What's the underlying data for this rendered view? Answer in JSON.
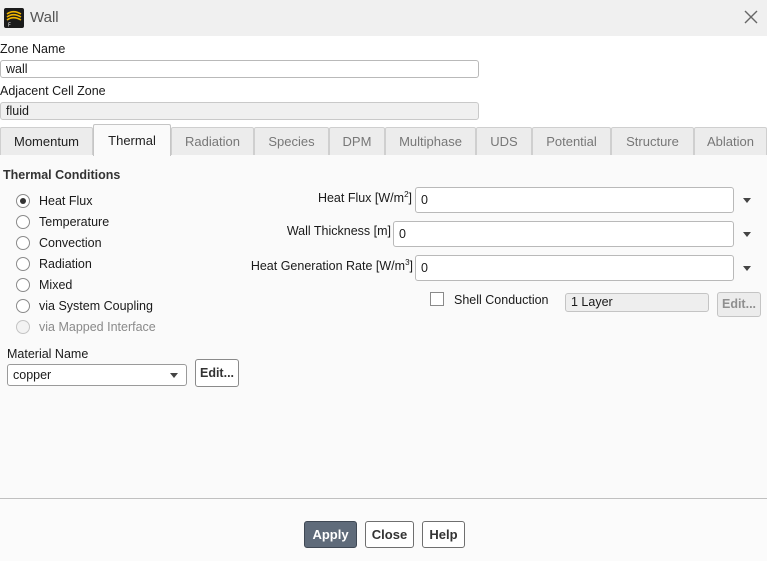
{
  "window": {
    "title": "Wall"
  },
  "upper": {
    "zone_name_label": "Zone Name",
    "zone_name_value": "wall",
    "adjacent_label": "Adjacent Cell Zone",
    "adjacent_value": "fluid"
  },
  "tabs": [
    {
      "label": "Momentum"
    },
    {
      "label": "Thermal"
    },
    {
      "label": "Radiation"
    },
    {
      "label": "Species"
    },
    {
      "label": "DPM"
    },
    {
      "label": "Multiphase"
    },
    {
      "label": "UDS"
    },
    {
      "label": "Potential"
    },
    {
      "label": "Structure"
    },
    {
      "label": "Ablation"
    }
  ],
  "active_tab": "Thermal",
  "thermal": {
    "section_title": "Thermal Conditions",
    "conditions": [
      {
        "label": "Heat Flux",
        "checked": true,
        "disabled": false
      },
      {
        "label": "Temperature",
        "checked": false,
        "disabled": false
      },
      {
        "label": "Convection",
        "checked": false,
        "disabled": false
      },
      {
        "label": "Radiation",
        "checked": false,
        "disabled": false
      },
      {
        "label": "Mixed",
        "checked": false,
        "disabled": false
      },
      {
        "label": "via System Coupling",
        "checked": false,
        "disabled": false
      },
      {
        "label": "via Mapped Interface",
        "checked": false,
        "disabled": true
      }
    ],
    "heat_flux": {
      "label": "Heat Flux [W/m",
      "sup": "2",
      "close": "]",
      "value": "0"
    },
    "wall_thickness": {
      "label": "Wall Thickness [m]",
      "value": "0"
    },
    "heat_generation": {
      "label": "Heat Generation Rate [W/m",
      "sup": "3",
      "close": "]",
      "value": "0"
    },
    "shell_conduction_label": "Shell Conduction",
    "shell_conduction_checked": false,
    "layers_value": "1 Layer",
    "layers_edit": "Edit...",
    "material_label": "Material Name",
    "material_value": "copper",
    "material_edit": "Edit..."
  },
  "footer": {
    "apply": "Apply",
    "close": "Close",
    "help": "Help"
  },
  "colors": {
    "apply_bg": "#5f6b7a",
    "panel_bg": "#fafafa",
    "window_bg": "#f0f0f0"
  }
}
